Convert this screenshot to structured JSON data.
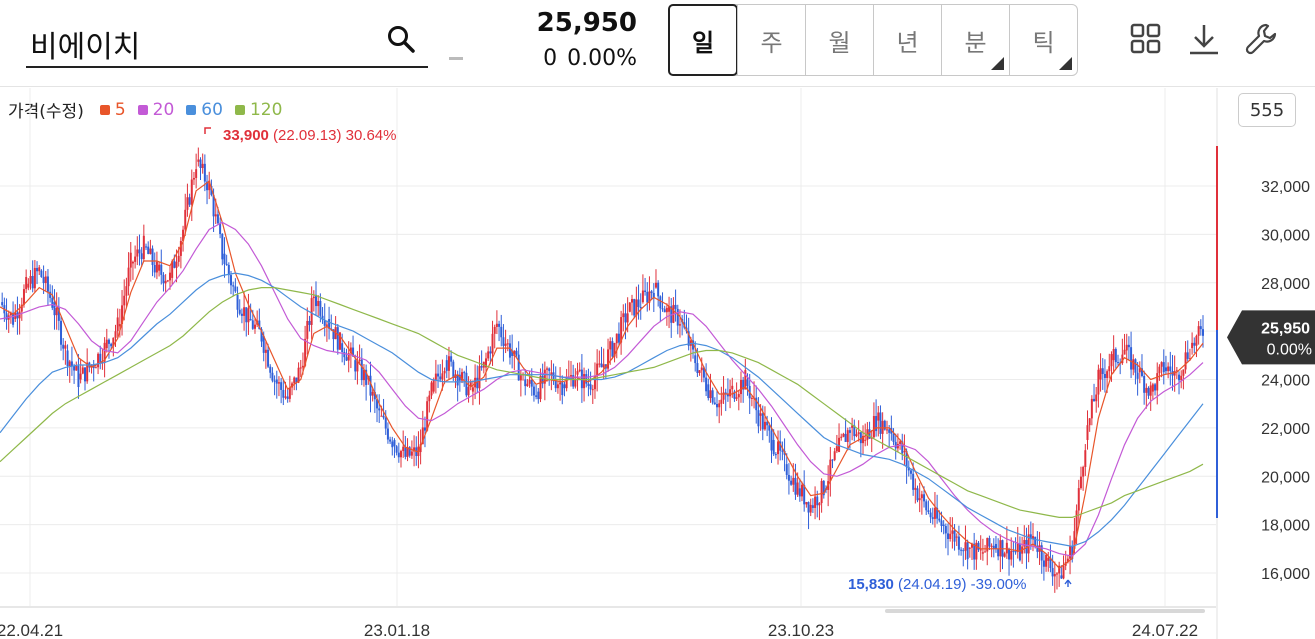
{
  "search": {
    "value": "비에이치",
    "icon": "search-icon"
  },
  "quote": {
    "price": "25,950",
    "change": "0",
    "change_pct": "0.00%"
  },
  "periods": [
    {
      "label": "일",
      "active": true,
      "has_menu": false
    },
    {
      "label": "주",
      "active": false,
      "has_menu": false
    },
    {
      "label": "월",
      "active": false,
      "has_menu": false
    },
    {
      "label": "년",
      "active": false,
      "has_menu": false
    },
    {
      "label": "분",
      "active": false,
      "has_menu": true
    },
    {
      "label": "틱",
      "active": false,
      "has_menu": true
    }
  ],
  "toolbar": {
    "icons": [
      "grid-icon",
      "download-icon",
      "wrench-icon"
    ]
  },
  "legend": {
    "label": "가격(수정)",
    "items": [
      {
        "label": "5",
        "color": "#e8552a"
      },
      {
        "label": "20",
        "color": "#c35ad6"
      },
      {
        "label": "60",
        "color": "#4a8fdc"
      },
      {
        "label": "120",
        "color": "#8fb84a"
      }
    ]
  },
  "candle_count": "555",
  "colors": {
    "up": "#e0303a",
    "down": "#2f5fd8",
    "badge": "#333333"
  },
  "chart_data": {
    "type": "candlestick",
    "y_ticks": [
      "16,000",
      "18,000",
      "20,000",
      "22,000",
      "24,000",
      "26,000",
      "28,000",
      "30,000",
      "32,000"
    ],
    "ylim": [
      15000,
      35500
    ],
    "x_ticks": [
      "22.04.21",
      "23.01.18",
      "23.10.23",
      "24.07.22"
    ],
    "high_marker": {
      "value": "33,900",
      "date": "(22.09.13)",
      "pct": "30.64%",
      "price": 33900
    },
    "low_marker": {
      "value": "15,830",
      "date": "(24.04.19)",
      "pct": "-39.00%",
      "price": 15830
    },
    "current": {
      "value": "25,950",
      "pct": "0.00%",
      "price": 25950
    },
    "close_series_approx": [
      27200,
      26500,
      27800,
      28500,
      27200,
      25200,
      24000,
      24600,
      25300,
      26200,
      28800,
      29500,
      28500,
      28200,
      30200,
      33000,
      32000,
      29200,
      27500,
      26500,
      25800,
      24000,
      23200,
      24500,
      27500,
      26500,
      25500,
      24800,
      24000,
      22500,
      21500,
      20800,
      21000,
      23500,
      24800,
      24200,
      23500,
      24500,
      26300,
      25200,
      24000,
      23500,
      24200,
      23800,
      24200,
      23800,
      24500,
      25500,
      26800,
      27200,
      27800,
      26800,
      26500,
      25000,
      23800,
      23000,
      23500,
      24000,
      22500,
      21500,
      20500,
      19500,
      18800,
      19500,
      21000,
      22000,
      21500,
      22300,
      22000,
      21000,
      19500,
      18500,
      18000,
      17500,
      17000,
      16800,
      17200,
      17000,
      16800,
      17500,
      16500,
      15900,
      17000,
      21500,
      24000,
      24800,
      25200,
      24300,
      23500,
      24500,
      24200,
      25300,
      26000
    ],
    "ma": [
      {
        "name": "5",
        "values": [
          27000,
          26700,
          27200,
          27800,
          27500,
          26200,
          24900,
          24500,
          24800,
          25700,
          27600,
          28900,
          28900,
          28700,
          29700,
          31800,
          32200,
          30500,
          28400,
          27100,
          26000,
          24800,
          23600,
          24000,
          25900,
          26200,
          25800,
          25000,
          24300,
          23000,
          22000,
          21200,
          21000,
          22400,
          23900,
          24200,
          23700,
          24100,
          25300,
          25300,
          24500,
          23800,
          24000,
          23900,
          24100,
          23900,
          24300,
          25000,
          26200,
          26900,
          27400,
          27100,
          26600,
          25500,
          24300,
          23400,
          23400,
          23700,
          23000,
          22000,
          21000,
          20000,
          19200,
          19300,
          20300,
          21300,
          21600,
          22000,
          22000,
          21400,
          20200,
          19100,
          18400,
          17800,
          17300,
          17000,
          17000,
          17000,
          16900,
          17200,
          16800,
          16200,
          16600,
          19300,
          22400,
          24200,
          24900,
          24600,
          24000,
          24200,
          24300,
          24800,
          25500
        ]
      },
      {
        "name": "20",
        "values": [
          26500,
          26600,
          26800,
          27000,
          27100,
          26900,
          26300,
          25600,
          25200,
          25100,
          25600,
          26400,
          27200,
          27800,
          28500,
          29400,
          30200,
          30500,
          30200,
          29600,
          28700,
          27600,
          26500,
          25700,
          25400,
          25200,
          25100,
          25000,
          24800,
          24300,
          23600,
          22900,
          22400,
          22300,
          22600,
          23000,
          23300,
          23600,
          24000,
          24300,
          24400,
          24300,
          24200,
          24100,
          24100,
          24100,
          24200,
          24500,
          25000,
          25600,
          26200,
          26600,
          26800,
          26700,
          26200,
          25500,
          24800,
          24200,
          23600,
          22900,
          22100,
          21300,
          20600,
          20100,
          20000,
          20200,
          20500,
          20900,
          21200,
          21300,
          21100,
          20600,
          19900,
          19200,
          18600,
          18100,
          17700,
          17400,
          17200,
          17100,
          17000,
          16800,
          16700,
          17200,
          18400,
          19900,
          21300,
          22400,
          23100,
          23500,
          23800,
          24200,
          24700
        ]
      },
      {
        "name": "60",
        "values": [
          21800,
          22500,
          23200,
          23800,
          24300,
          24500,
          24600,
          24600,
          24700,
          24900,
          25300,
          25800,
          26300,
          26700,
          27200,
          27700,
          28100,
          28300,
          28400,
          28300,
          28100,
          27800,
          27400,
          27000,
          26700,
          26400,
          26200,
          26000,
          25700,
          25400,
          25100,
          24700,
          24300,
          24000,
          23900,
          23900,
          23900,
          24000,
          24100,
          24200,
          24200,
          24200,
          24200,
          24100,
          24000,
          24000,
          24000,
          24100,
          24300,
          24600,
          24900,
          25200,
          25400,
          25500,
          25400,
          25200,
          24900,
          24500,
          24100,
          23600,
          23100,
          22600,
          22100,
          21600,
          21300,
          21100,
          20900,
          20800,
          20700,
          20500,
          20200,
          19900,
          19500,
          19100,
          18700,
          18400,
          18100,
          17800,
          17600,
          17400,
          17300,
          17200,
          17100,
          17300,
          17700,
          18200,
          18800,
          19500,
          20200,
          20900,
          21600,
          22300,
          23000
        ]
      },
      {
        "name": "120",
        "values": [
          20600,
          21100,
          21600,
          22100,
          22600,
          23000,
          23300,
          23600,
          23900,
          24200,
          24500,
          24800,
          25100,
          25400,
          25800,
          26300,
          26800,
          27200,
          27500,
          27700,
          27800,
          27800,
          27700,
          27600,
          27500,
          27300,
          27100,
          26900,
          26700,
          26500,
          26300,
          26100,
          25900,
          25600,
          25300,
          25000,
          24800,
          24600,
          24400,
          24300,
          24200,
          24100,
          24000,
          24000,
          24000,
          24000,
          24100,
          24200,
          24300,
          24400,
          24500,
          24700,
          24900,
          25100,
          25200,
          25200,
          25100,
          24900,
          24700,
          24400,
          24100,
          23800,
          23400,
          23000,
          22600,
          22200,
          21800,
          21500,
          21200,
          20900,
          20600,
          20300,
          20000,
          19700,
          19400,
          19200,
          19000,
          18800,
          18600,
          18500,
          18400,
          18300,
          18300,
          18500,
          18700,
          18900,
          19200,
          19400,
          19600,
          19800,
          20000,
          20200,
          20500
        ]
      }
    ]
  }
}
